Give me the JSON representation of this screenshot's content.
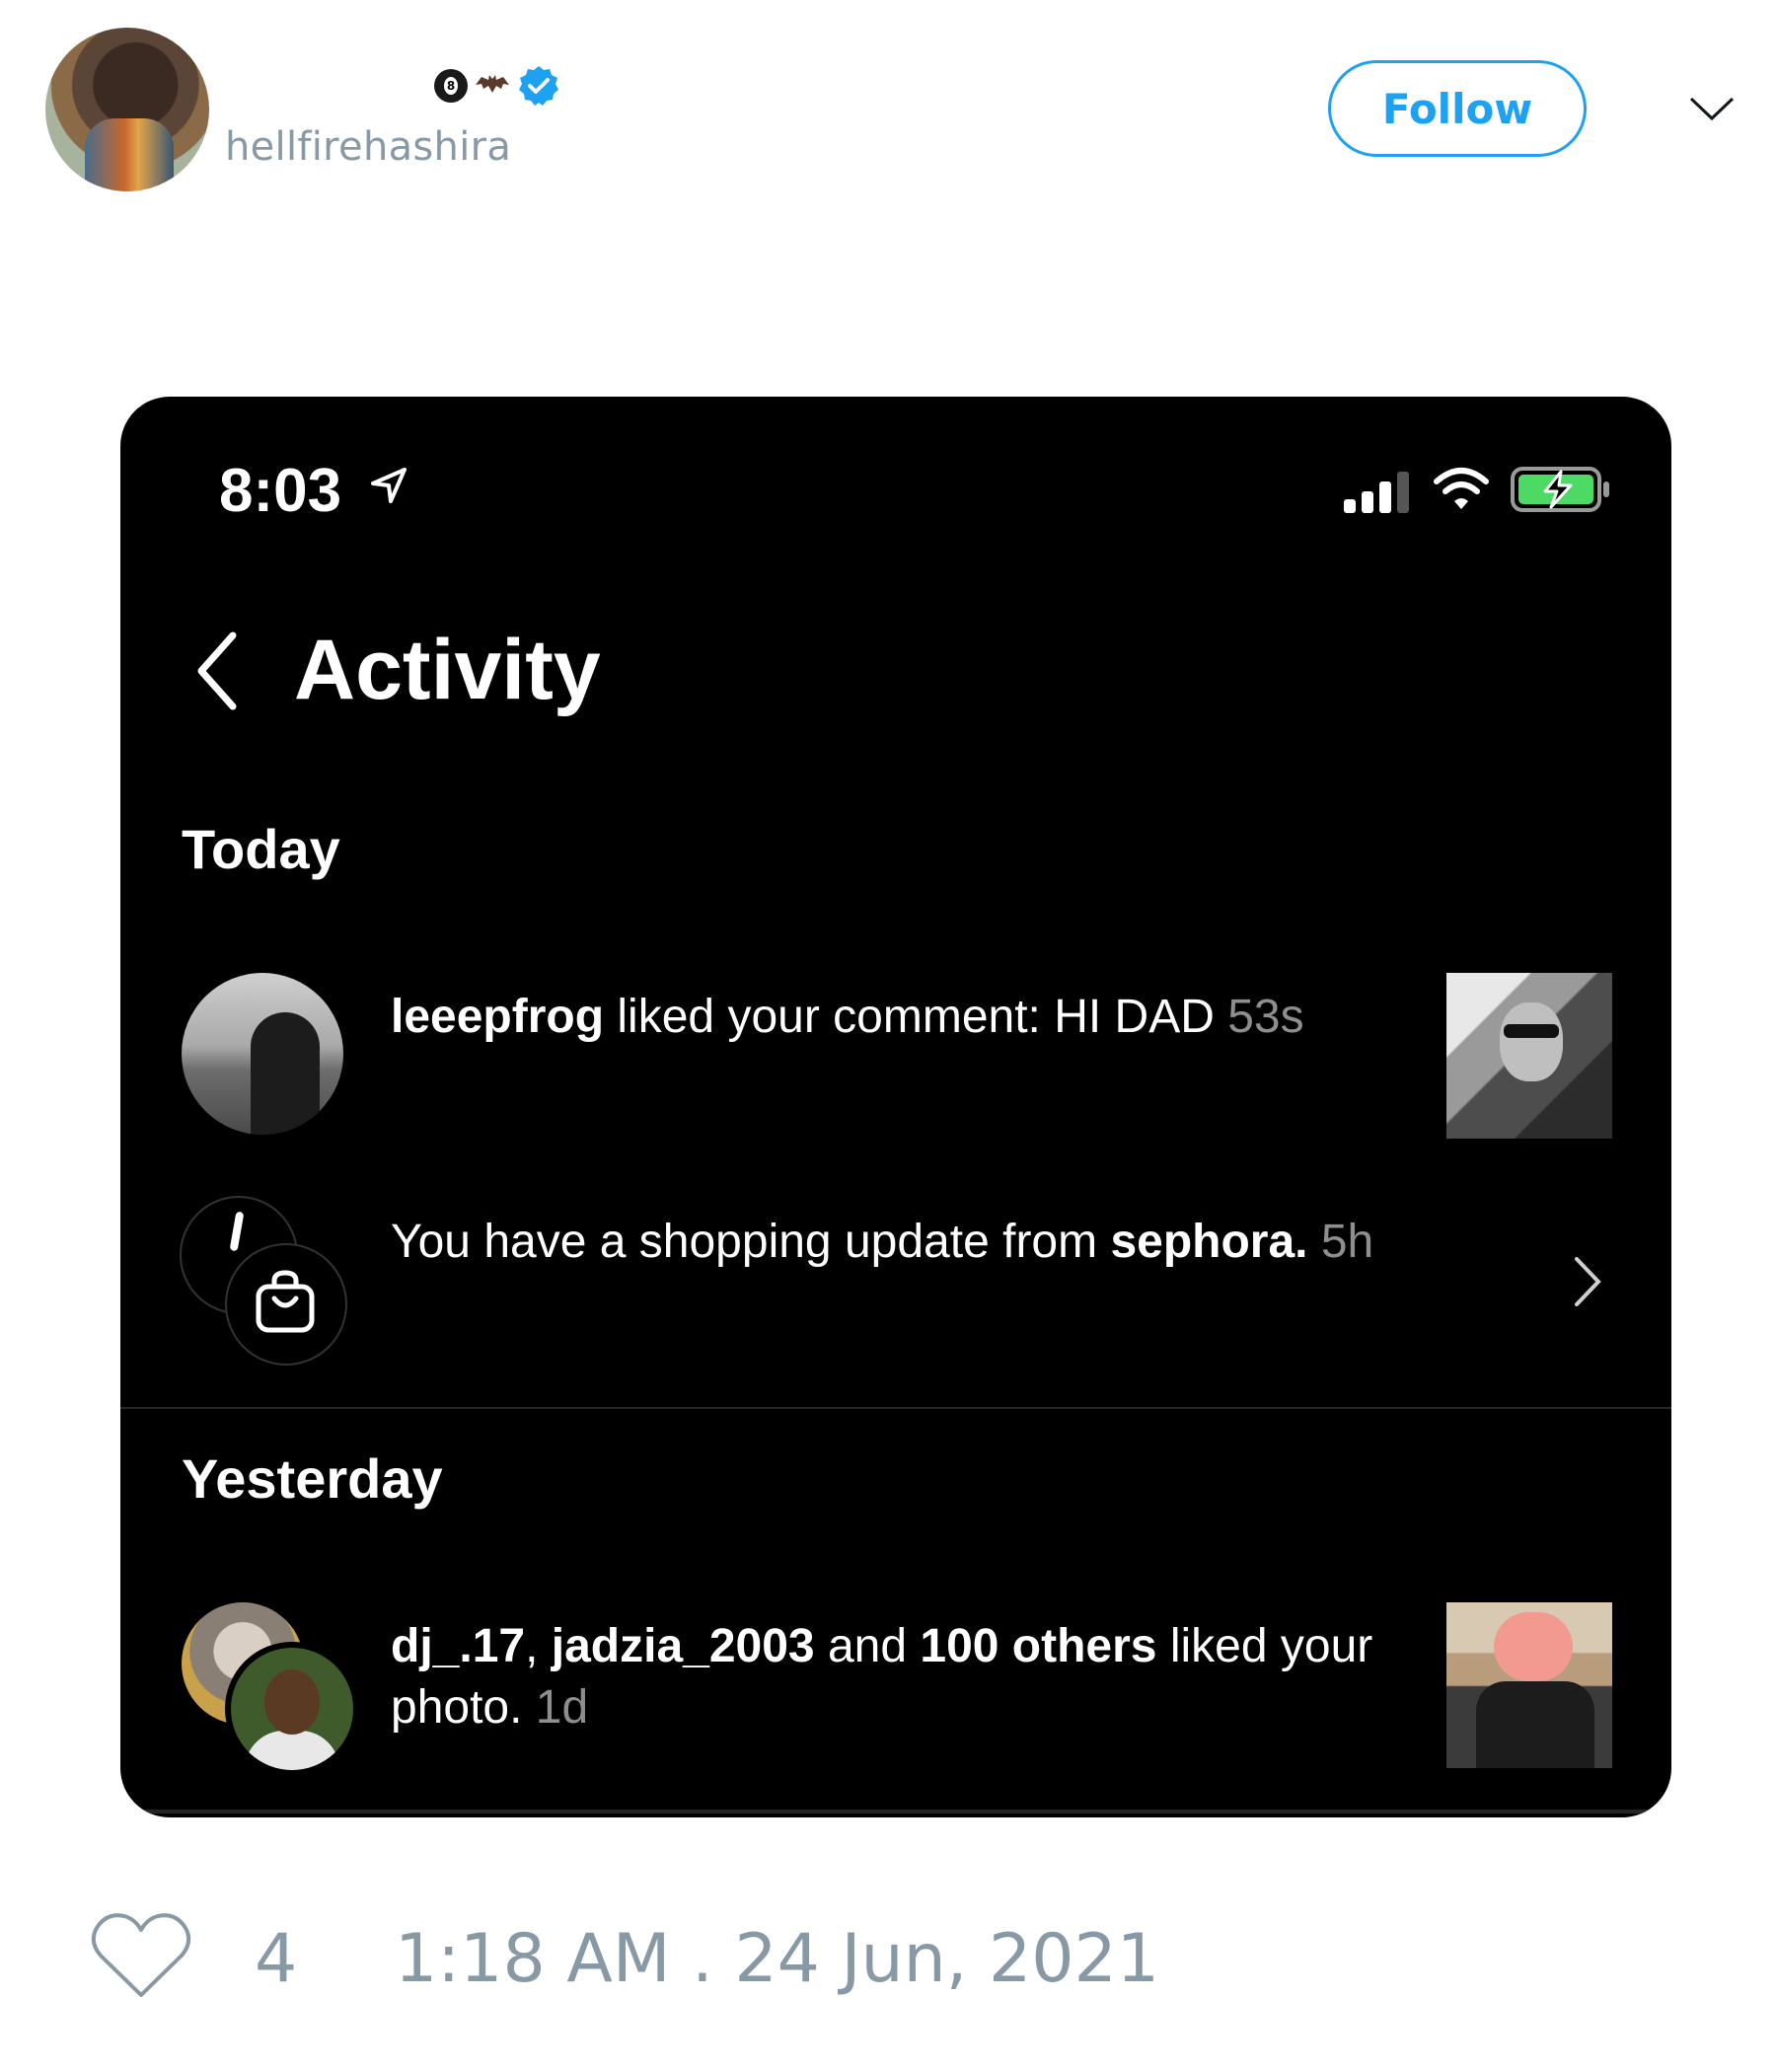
{
  "tweet": {
    "handle": "hellfirehashira",
    "display_emojis": [
      "8ball",
      "bat"
    ],
    "verified": true,
    "follow_label": "Follow",
    "like_count": "4",
    "timestamp": "1:18 AM . 24 Jun, 2021",
    "accent_color": "#1da1f2",
    "muted_color": "#8899a6"
  },
  "phone": {
    "status_time": "8:03",
    "title": "Activity",
    "sections": {
      "today": "Today",
      "yesterday": "Yesterday"
    },
    "notifications": [
      {
        "user": "leeepfrog",
        "text": " liked your comment: HI DAD ",
        "time": "53s"
      },
      {
        "prefix": "You have a shopping update from ",
        "brand": "sephora.",
        "time": " 5h"
      },
      {
        "user1": "dj_.17",
        "sep1": ", ",
        "user2": "jadzia_2003",
        "sep2": " and ",
        "others": "100 others",
        "text": " liked your photo. ",
        "time": "1d"
      }
    ]
  }
}
